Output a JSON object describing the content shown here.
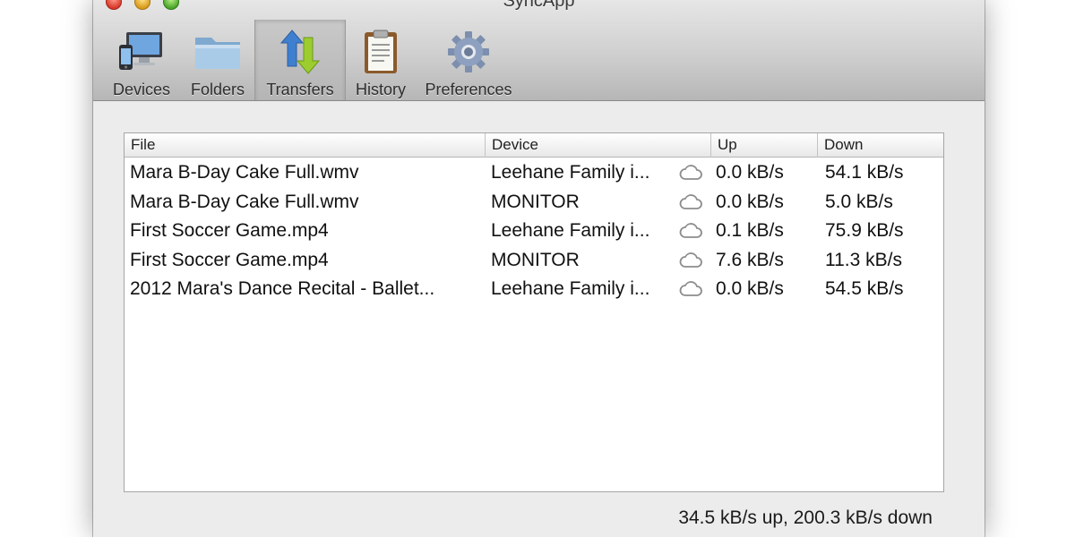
{
  "window": {
    "title": "SyncApp"
  },
  "toolbar": {
    "items": [
      {
        "label": "Devices",
        "icon": "devices-icon",
        "selected": false
      },
      {
        "label": "Folders",
        "icon": "folder-icon",
        "selected": false
      },
      {
        "label": "Transfers",
        "icon": "transfers-icon",
        "selected": true
      },
      {
        "label": "History",
        "icon": "clipboard-icon",
        "selected": false
      },
      {
        "label": "Preferences",
        "icon": "gear-icon",
        "selected": false
      }
    ]
  },
  "table": {
    "columns": {
      "file": "File",
      "device": "Device",
      "up": "Up",
      "down": "Down"
    },
    "rows": [
      {
        "file": "Mara B-Day Cake Full.wmv",
        "device": "Leehane Family i...",
        "up": "0.0 kB/s",
        "down": "54.1 kB/s"
      },
      {
        "file": "Mara B-Day Cake Full.wmv",
        "device": "MONITOR",
        "up": "0.0 kB/s",
        "down": "5.0 kB/s"
      },
      {
        "file": "First Soccer Game.mp4",
        "device": "Leehane Family i...",
        "up": "0.1 kB/s",
        "down": "75.9 kB/s"
      },
      {
        "file": "First Soccer Game.mp4",
        "device": "MONITOR",
        "up": "7.6 kB/s",
        "down": "11.3 kB/s"
      },
      {
        "file": "2012 Mara's Dance Recital - Ballet...",
        "device": "Leehane Family i...",
        "up": "0.0 kB/s",
        "down": "54.5 kB/s"
      }
    ]
  },
  "status": {
    "text": "34.5 kB/s up, 200.3 kB/s down"
  }
}
